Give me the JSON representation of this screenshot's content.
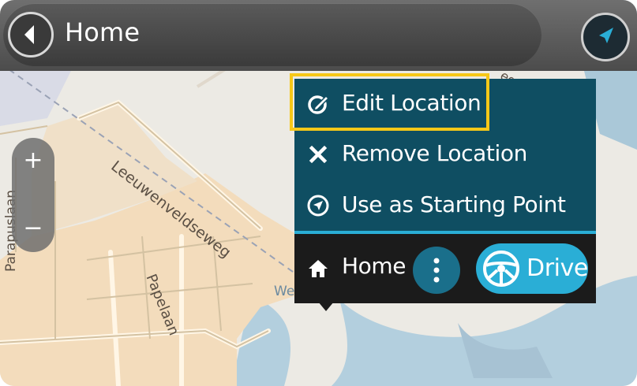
{
  "header": {
    "title": "Home",
    "back_icon": "back-arrow-icon",
    "nav_icon": "navigation-arrow-icon"
  },
  "map": {
    "street_labels": [
      "Leeuwenveldseweg",
      "Parapuslaan",
      "Papelaan",
      "We"
    ],
    "partial_label_top": "eg"
  },
  "zoom": {
    "in_label": "+",
    "out_label": "−"
  },
  "popup": {
    "menu_items": [
      {
        "label": "Edit Location",
        "icon": "edit-location-icon",
        "highlighted": true
      },
      {
        "label": "Remove Location",
        "icon": "remove-x-icon"
      },
      {
        "label": "Use as Starting Point",
        "icon": "starting-point-icon"
      }
    ],
    "footer": {
      "label": "Home",
      "icon": "home-icon",
      "more_icon": "more-vertical-icon",
      "drive_label": "Drive",
      "drive_icon": "steering-wheel-icon"
    }
  },
  "colors": {
    "popup_menu_bg": "#0f4e62",
    "popup_footer_bg": "#1b1b1b",
    "accent_blue": "#2aaed6",
    "highlight": "#f6c818",
    "top_bar": "#4c4c4c"
  }
}
